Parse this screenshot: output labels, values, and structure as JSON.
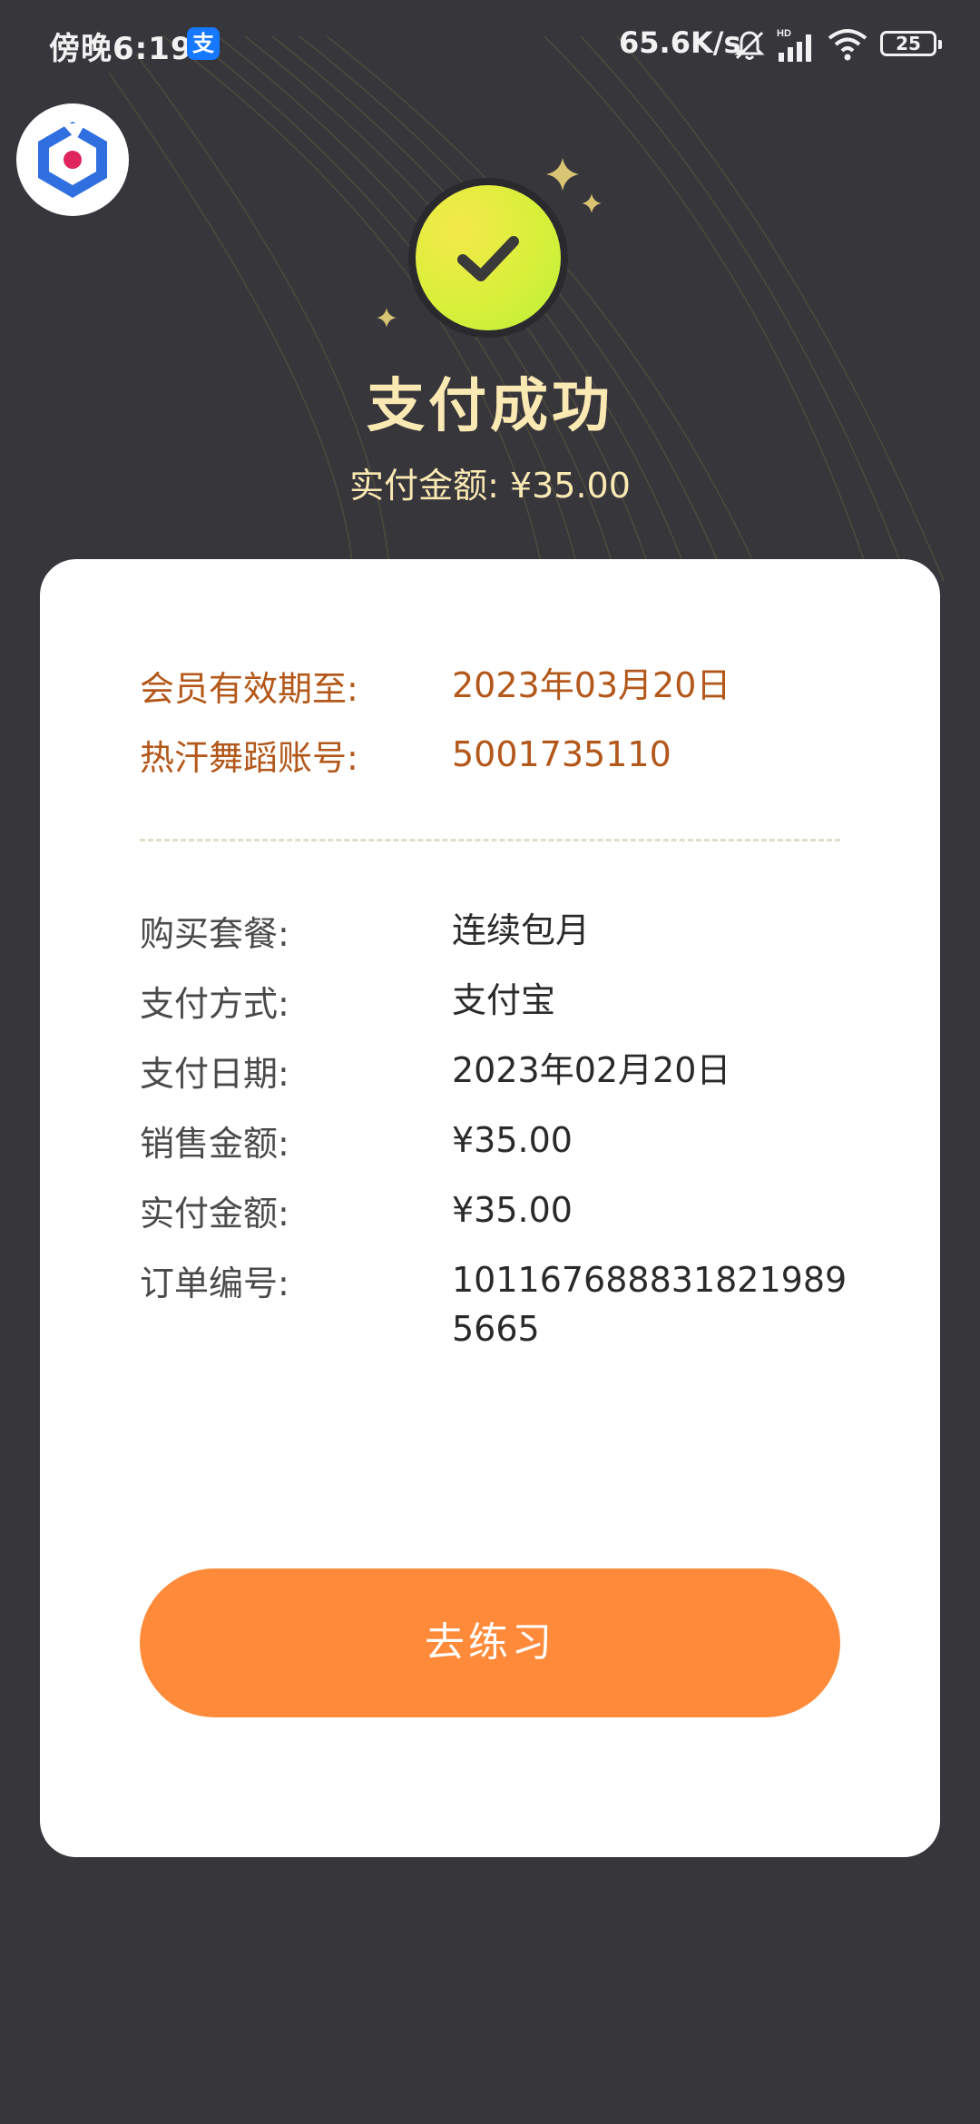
{
  "status_bar": {
    "time": "傍晚6:19",
    "app_badge": "支",
    "net_speed": "65.6K/s",
    "battery": "25"
  },
  "header": {
    "title": "支付成功",
    "paid_summary": "实付金额: ¥35.00"
  },
  "membership": [
    {
      "label": "会员有效期至:",
      "value": "2023年03月20日"
    },
    {
      "label": "热汗舞蹈账号:",
      "value": "5001735110"
    }
  ],
  "order_details": [
    {
      "label": "购买套餐:",
      "value": "连续包月"
    },
    {
      "label": "支付方式:",
      "value": "支付宝"
    },
    {
      "label": "支付日期:",
      "value": "2023年02月20日"
    },
    {
      "label": "销售金额:",
      "value": "¥35.00"
    },
    {
      "label": "实付金额:",
      "value": "¥35.00"
    },
    {
      "label": "订单编号:",
      "value": "1011676888318219895665"
    }
  ],
  "actions": {
    "practice_button": "去练习"
  },
  "colors": {
    "background": "#37363b",
    "accent_gold": "#fbe9b4",
    "highlight_text": "#b3581a",
    "button": "#ff8a3a"
  }
}
